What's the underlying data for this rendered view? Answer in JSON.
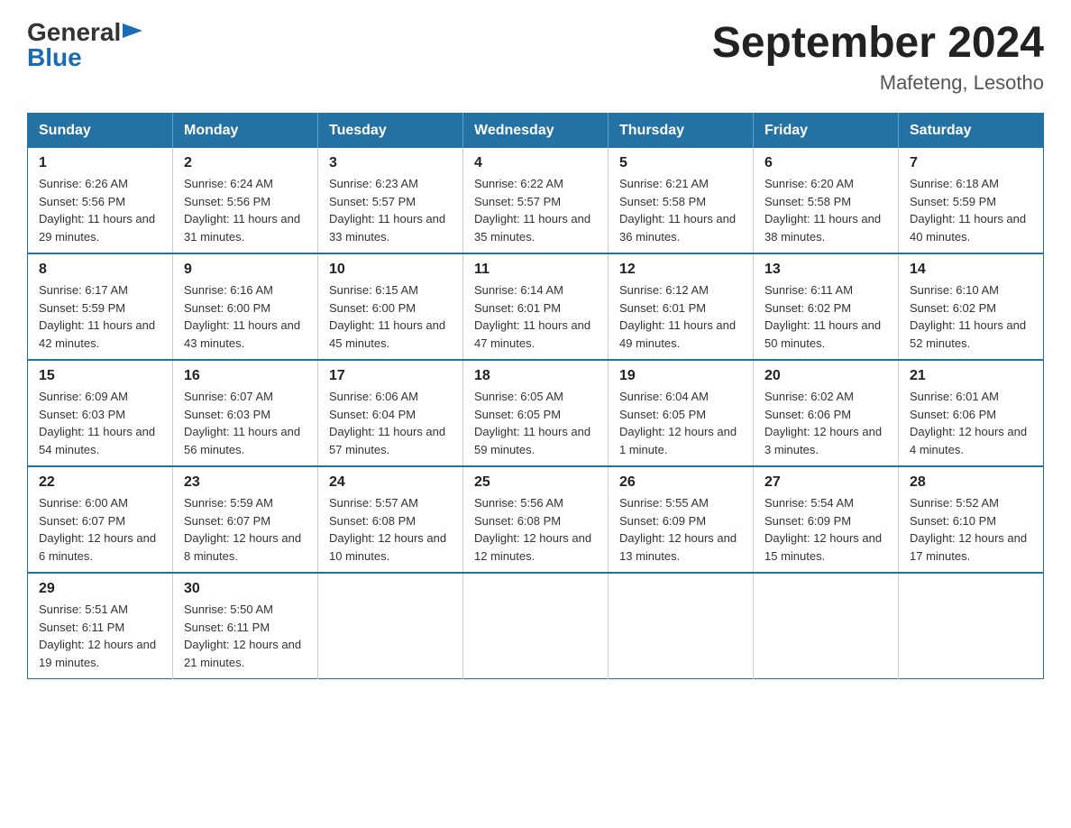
{
  "header": {
    "logo_general": "General",
    "logo_blue": "Blue",
    "title": "September 2024",
    "subtitle": "Mafeteng, Lesotho"
  },
  "days_of_week": [
    "Sunday",
    "Monday",
    "Tuesday",
    "Wednesday",
    "Thursday",
    "Friday",
    "Saturday"
  ],
  "weeks": [
    [
      {
        "day": "1",
        "sunrise": "Sunrise: 6:26 AM",
        "sunset": "Sunset: 5:56 PM",
        "daylight": "Daylight: 11 hours and 29 minutes."
      },
      {
        "day": "2",
        "sunrise": "Sunrise: 6:24 AM",
        "sunset": "Sunset: 5:56 PM",
        "daylight": "Daylight: 11 hours and 31 minutes."
      },
      {
        "day": "3",
        "sunrise": "Sunrise: 6:23 AM",
        "sunset": "Sunset: 5:57 PM",
        "daylight": "Daylight: 11 hours and 33 minutes."
      },
      {
        "day": "4",
        "sunrise": "Sunrise: 6:22 AM",
        "sunset": "Sunset: 5:57 PM",
        "daylight": "Daylight: 11 hours and 35 minutes."
      },
      {
        "day": "5",
        "sunrise": "Sunrise: 6:21 AM",
        "sunset": "Sunset: 5:58 PM",
        "daylight": "Daylight: 11 hours and 36 minutes."
      },
      {
        "day": "6",
        "sunrise": "Sunrise: 6:20 AM",
        "sunset": "Sunset: 5:58 PM",
        "daylight": "Daylight: 11 hours and 38 minutes."
      },
      {
        "day": "7",
        "sunrise": "Sunrise: 6:18 AM",
        "sunset": "Sunset: 5:59 PM",
        "daylight": "Daylight: 11 hours and 40 minutes."
      }
    ],
    [
      {
        "day": "8",
        "sunrise": "Sunrise: 6:17 AM",
        "sunset": "Sunset: 5:59 PM",
        "daylight": "Daylight: 11 hours and 42 minutes."
      },
      {
        "day": "9",
        "sunrise": "Sunrise: 6:16 AM",
        "sunset": "Sunset: 6:00 PM",
        "daylight": "Daylight: 11 hours and 43 minutes."
      },
      {
        "day": "10",
        "sunrise": "Sunrise: 6:15 AM",
        "sunset": "Sunset: 6:00 PM",
        "daylight": "Daylight: 11 hours and 45 minutes."
      },
      {
        "day": "11",
        "sunrise": "Sunrise: 6:14 AM",
        "sunset": "Sunset: 6:01 PM",
        "daylight": "Daylight: 11 hours and 47 minutes."
      },
      {
        "day": "12",
        "sunrise": "Sunrise: 6:12 AM",
        "sunset": "Sunset: 6:01 PM",
        "daylight": "Daylight: 11 hours and 49 minutes."
      },
      {
        "day": "13",
        "sunrise": "Sunrise: 6:11 AM",
        "sunset": "Sunset: 6:02 PM",
        "daylight": "Daylight: 11 hours and 50 minutes."
      },
      {
        "day": "14",
        "sunrise": "Sunrise: 6:10 AM",
        "sunset": "Sunset: 6:02 PM",
        "daylight": "Daylight: 11 hours and 52 minutes."
      }
    ],
    [
      {
        "day": "15",
        "sunrise": "Sunrise: 6:09 AM",
        "sunset": "Sunset: 6:03 PM",
        "daylight": "Daylight: 11 hours and 54 minutes."
      },
      {
        "day": "16",
        "sunrise": "Sunrise: 6:07 AM",
        "sunset": "Sunset: 6:03 PM",
        "daylight": "Daylight: 11 hours and 56 minutes."
      },
      {
        "day": "17",
        "sunrise": "Sunrise: 6:06 AM",
        "sunset": "Sunset: 6:04 PM",
        "daylight": "Daylight: 11 hours and 57 minutes."
      },
      {
        "day": "18",
        "sunrise": "Sunrise: 6:05 AM",
        "sunset": "Sunset: 6:05 PM",
        "daylight": "Daylight: 11 hours and 59 minutes."
      },
      {
        "day": "19",
        "sunrise": "Sunrise: 6:04 AM",
        "sunset": "Sunset: 6:05 PM",
        "daylight": "Daylight: 12 hours and 1 minute."
      },
      {
        "day": "20",
        "sunrise": "Sunrise: 6:02 AM",
        "sunset": "Sunset: 6:06 PM",
        "daylight": "Daylight: 12 hours and 3 minutes."
      },
      {
        "day": "21",
        "sunrise": "Sunrise: 6:01 AM",
        "sunset": "Sunset: 6:06 PM",
        "daylight": "Daylight: 12 hours and 4 minutes."
      }
    ],
    [
      {
        "day": "22",
        "sunrise": "Sunrise: 6:00 AM",
        "sunset": "Sunset: 6:07 PM",
        "daylight": "Daylight: 12 hours and 6 minutes."
      },
      {
        "day": "23",
        "sunrise": "Sunrise: 5:59 AM",
        "sunset": "Sunset: 6:07 PM",
        "daylight": "Daylight: 12 hours and 8 minutes."
      },
      {
        "day": "24",
        "sunrise": "Sunrise: 5:57 AM",
        "sunset": "Sunset: 6:08 PM",
        "daylight": "Daylight: 12 hours and 10 minutes."
      },
      {
        "day": "25",
        "sunrise": "Sunrise: 5:56 AM",
        "sunset": "Sunset: 6:08 PM",
        "daylight": "Daylight: 12 hours and 12 minutes."
      },
      {
        "day": "26",
        "sunrise": "Sunrise: 5:55 AM",
        "sunset": "Sunset: 6:09 PM",
        "daylight": "Daylight: 12 hours and 13 minutes."
      },
      {
        "day": "27",
        "sunrise": "Sunrise: 5:54 AM",
        "sunset": "Sunset: 6:09 PM",
        "daylight": "Daylight: 12 hours and 15 minutes."
      },
      {
        "day": "28",
        "sunrise": "Sunrise: 5:52 AM",
        "sunset": "Sunset: 6:10 PM",
        "daylight": "Daylight: 12 hours and 17 minutes."
      }
    ],
    [
      {
        "day": "29",
        "sunrise": "Sunrise: 5:51 AM",
        "sunset": "Sunset: 6:11 PM",
        "daylight": "Daylight: 12 hours and 19 minutes."
      },
      {
        "day": "30",
        "sunrise": "Sunrise: 5:50 AM",
        "sunset": "Sunset: 6:11 PM",
        "daylight": "Daylight: 12 hours and 21 minutes."
      },
      null,
      null,
      null,
      null,
      null
    ]
  ]
}
